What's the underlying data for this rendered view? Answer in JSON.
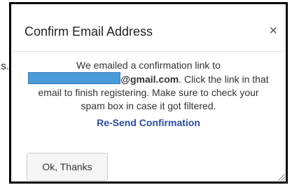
{
  "background": {
    "partial_text": "s."
  },
  "modal": {
    "title": "Confirm Email Address",
    "close_glyph": "×",
    "close_icon": "close-icon",
    "body_line1": "We emailed a confirmation link to",
    "email_domain": "@gmail.com",
    "body_line2_rest": ". Click the link in that",
    "body_line3": "email to finish registering. Make sure to check your",
    "body_line4": "spam box in case it got filtered.",
    "resend_link": "Re-Send Confirmation",
    "ok_button": "Ok, Thanks",
    "resize_icon": "resize-grip-icon"
  },
  "colors": {
    "redaction_fill": "#4b9bd9",
    "link": "#2c4da8",
    "modal_border": "#000000"
  }
}
